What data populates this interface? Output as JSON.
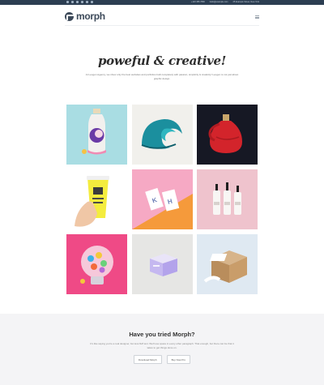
{
  "topbar": {
    "social_icons": [
      "facebook-icon",
      "twitter-icon",
      "google-plus-icon",
      "pinterest-icon",
      "instagram-icon",
      "youtube-icon"
    ],
    "phone": "+123 456 7890",
    "email": "hello@example.com",
    "address": "25 Example Street, New York"
  },
  "header": {
    "logo_text": "morph"
  },
  "hero": {
    "title": "poweful & creative!",
    "description": "At Leogen Agency, we show only the best websites and portfolios built completely with passion, simplicity & creativity! Leogen is not just about graphic design."
  },
  "gallery": [
    {
      "name": "bottle-illustration",
      "bg": "#a9dde3"
    },
    {
      "name": "wave-logo",
      "bg": "#f1f0ec"
    },
    {
      "name": "red-vase",
      "bg": "#161824"
    },
    {
      "name": "coffee-cup",
      "bg": "#ffffff"
    },
    {
      "name": "business-cards",
      "bg": "#f6a9c4"
    },
    {
      "name": "cosmetic-bottles",
      "bg": "#efc3cd"
    },
    {
      "name": "candy-machine",
      "bg": "#ef4a86"
    },
    {
      "name": "purple-box",
      "bg": "#e6e6e4"
    },
    {
      "name": "cardboard-box",
      "bg": "#dfe9f2"
    }
  ],
  "cta": {
    "title": "Have you tried Morph?",
    "text": "It's like saying you're a real designer, but less fluff text. We'll use space in every other paragraph. That enough, but there can be that it takes to get things done on.",
    "primary_button": "Download Morph",
    "secondary_button": "Buy Now Pro"
  }
}
